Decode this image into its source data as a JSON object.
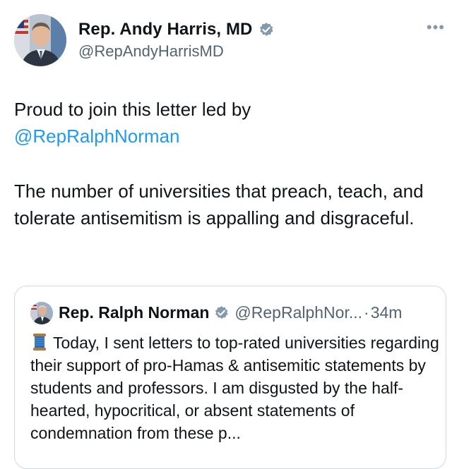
{
  "author": {
    "name": "Rep. Andy Harris, MD",
    "handle": "@RepAndyHarrisMD",
    "verified_color": "#829aab"
  },
  "menu": {
    "more_label": "•••"
  },
  "post": {
    "line1": "Proud to join this letter led by",
    "mention": "@RepRalphNorman",
    "paragraph2": "The number of universities that preach, teach, and tolerate antisemitism is appalling and disgraceful."
  },
  "quoted": {
    "name": "Rep. Ralph Norman",
    "handle": "@RepRalphNor...",
    "separator": "·",
    "time": "34m",
    "emoji_icon": "spool-of-thread-icon",
    "text": "Today, I sent letters to top-rated universities regarding their support of pro-Hamas & antisemitic statements by students and professors. I am disgusted by the half-hearted, hypocritical, or absent statements of condemnation from these p..."
  },
  "colors": {
    "link": "#1d9bf0",
    "secondary_text": "#536471",
    "border": "#cfd9de"
  }
}
